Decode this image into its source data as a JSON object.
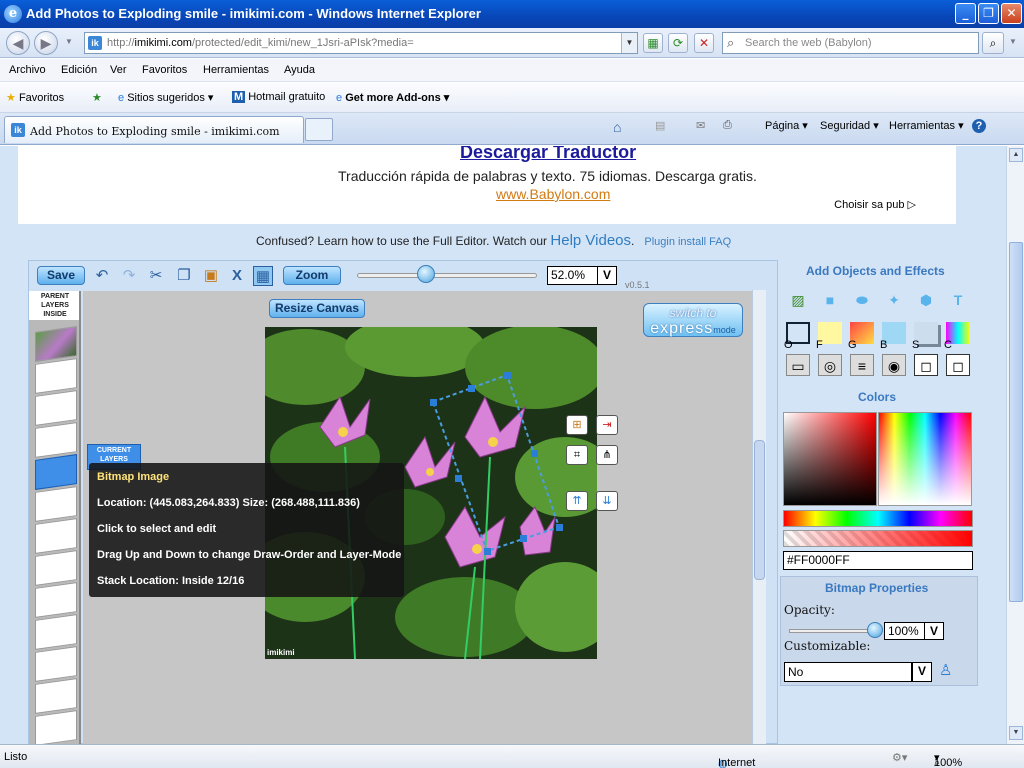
{
  "window": {
    "title": "Add Photos to Exploding smile - imikimi.com - Windows Internet Explorer",
    "minimize_label": "_",
    "maximize_label": "❐",
    "close_label": "✕"
  },
  "address_bar": {
    "url_host_prefix": "http://",
    "url_domain": "imikimi.com",
    "url_path": "/protected/edit_kimi/new_1Jsri-aPIsk?media=",
    "search_placeholder": "Search the web (Babylon)"
  },
  "menu": [
    "Archivo",
    "Edición",
    "Ver",
    "Favoritos",
    "Herramientas",
    "Ayuda"
  ],
  "favorites_bar": {
    "favorites": "Favoritos",
    "suggested": "Sitios sugeridos ▾",
    "hotmail": "Hotmail gratuito",
    "addons": "Get more Add-ons ▾"
  },
  "tab": {
    "label": "Add Photos to Exploding smile - imikimi.com"
  },
  "command_bar": {
    "page": "Página ▾",
    "security": "Seguridad ▾",
    "tools": "Herramientas ▾"
  },
  "ad": {
    "headline": "Descargar Traductor",
    "text": "Traducción rápida de palabras y texto. 75 idiomas. Descarga gratis.",
    "url": "www.Babylon.com",
    "choisir": "Choisir sa pub ▷"
  },
  "help": {
    "confused": "Confused? Learn how to use the Full Editor. Watch our ",
    "help_videos": "Help Videos",
    "plugin_faq": "Plugin install FAQ"
  },
  "editor": {
    "save": "Save",
    "zoom": "Zoom",
    "zoom_value": "52.0%",
    "zoom_level": 0.52,
    "dropdown_v": "V",
    "version": "v0.5.1",
    "resize_canvas": "Resize Canvas",
    "switch_to": "switch to",
    "express": "express",
    "mode": "mode",
    "parent_layers": [
      "PARENT",
      "LAYERS",
      "INSIDE"
    ],
    "current_layers": [
      "CURRENT",
      "LAYERS"
    ],
    "watermark": "imikimi"
  },
  "tooltip": {
    "title": "Bitmap Image",
    "location": "Location: (445.083,264.833) Size: (268.488,111.836)",
    "click": "Click to select and edit",
    "drag": "Drag Up and Down to change Draw-Order and Layer-Mode",
    "stack": "Stack Location: Inside 12/16"
  },
  "right_panel": {
    "add_objects_title": "Add Objects and Effects",
    "effect_letters": [
      "O",
      "F",
      "G",
      "B",
      "S",
      "C"
    ],
    "colors_title": "Colors",
    "hex_value": "#FF0000FF",
    "bitmap_props_title": "Bitmap Properties",
    "opacity_label": "Opacity:",
    "opacity_value": "100%",
    "opacity_level": 1.0,
    "customizable_label": "Customizable:",
    "customizable_value": "No"
  },
  "status_bar": {
    "left": "Listo",
    "zone": "Internet",
    "zoom": "100%"
  },
  "colors": {
    "accent_blue": "#3a78c0",
    "title_bar": "#0846b8",
    "current_color": "#FF0000"
  }
}
